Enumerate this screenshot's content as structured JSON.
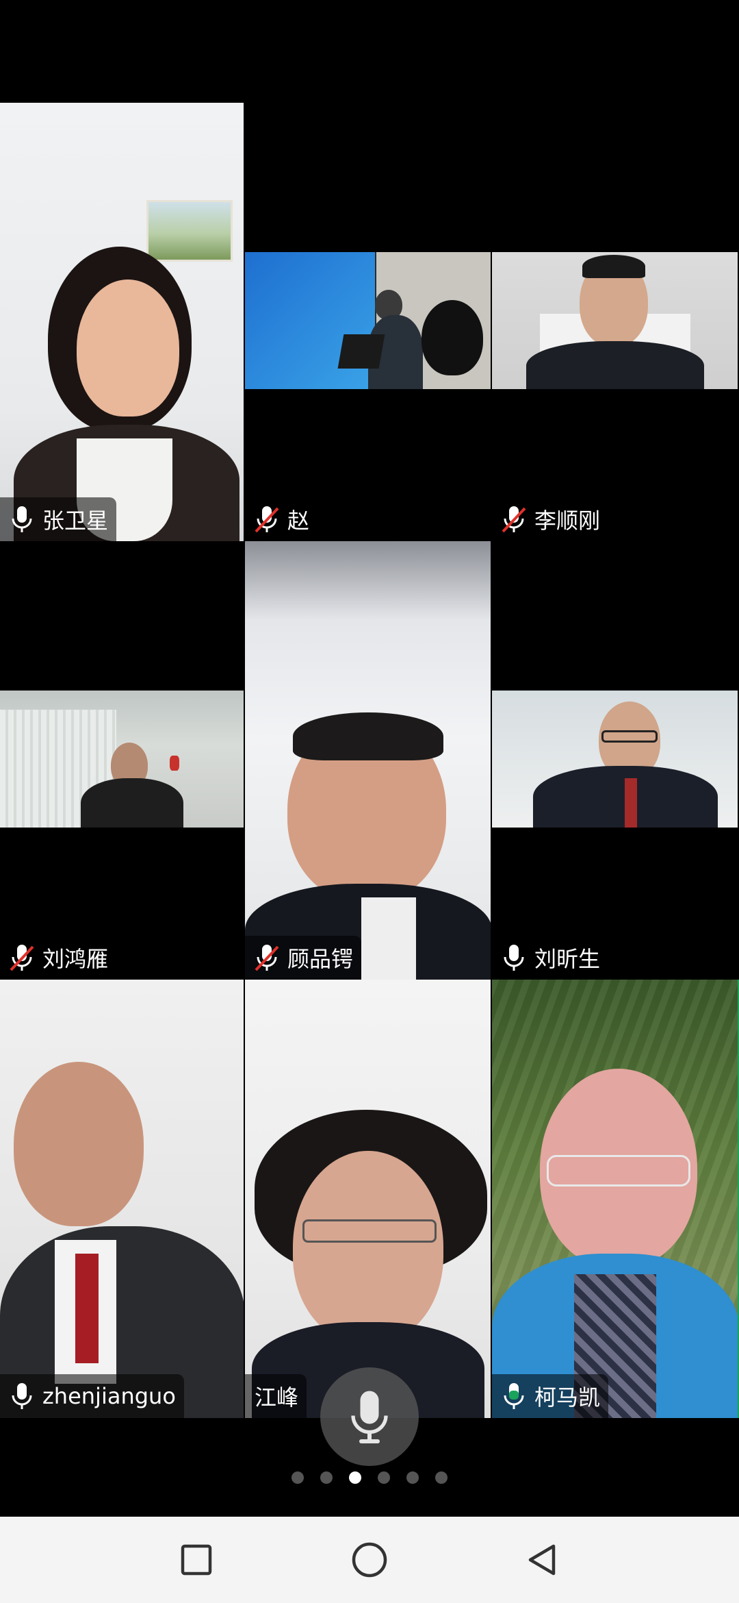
{
  "participants": [
    {
      "name": "张卫星",
      "mic": "on",
      "active": false
    },
    {
      "name": "赵",
      "mic": "muted",
      "active": false
    },
    {
      "name": "李顺刚",
      "mic": "muted",
      "active": false
    },
    {
      "name": "刘鸿雁",
      "mic": "muted",
      "active": false
    },
    {
      "name": "顾品锷",
      "mic": "muted",
      "active": false
    },
    {
      "name": "刘昕生",
      "mic": "on",
      "active": false
    },
    {
      "name": "zhenjianguo",
      "mic": "on",
      "active": false
    },
    {
      "name": "江峰",
      "mic": "none",
      "active": false
    },
    {
      "name": "柯马凯",
      "mic": "speaking",
      "active": true
    }
  ],
  "pager": {
    "total": 6,
    "current_index": 2
  },
  "colors": {
    "speaking_green": "#1aa35a",
    "muted_red": "#e0312b",
    "label_bg": "rgba(0,0,0,0.55)"
  },
  "icons": {
    "mic": "microphone-icon",
    "mic_muted": "microphone-muted-icon",
    "nav_recent": "square-icon",
    "nav_home": "circle-icon",
    "nav_back": "triangle-back-icon"
  }
}
